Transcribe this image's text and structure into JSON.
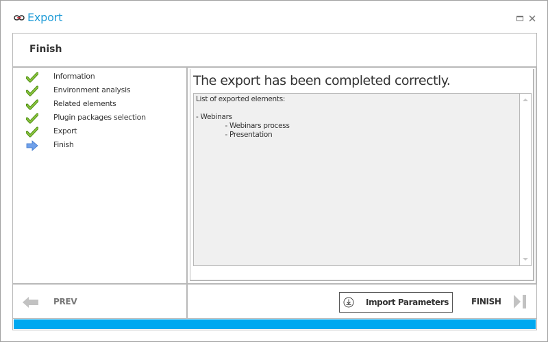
{
  "window": {
    "title": "Export",
    "title_icon": "link-icon",
    "controls": [
      {
        "name": "maximize",
        "icon": "maximize-icon"
      },
      {
        "name": "close",
        "icon": "close-icon"
      }
    ]
  },
  "header": {
    "title": "Finish"
  },
  "steps": [
    {
      "label": "Information",
      "status": "done",
      "icon": "check-icon"
    },
    {
      "label": "Environment analysis",
      "status": "done",
      "icon": "check-icon"
    },
    {
      "label": "Related elements",
      "status": "done",
      "icon": "check-icon"
    },
    {
      "label": "Plugin packages selection",
      "status": "done",
      "icon": "check-icon"
    },
    {
      "label": "Export",
      "status": "done",
      "icon": "check-icon"
    },
    {
      "label": "Finish",
      "status": "current",
      "icon": "arrow-right-icon"
    }
  ],
  "result": {
    "message": "The export has been completed correctly.",
    "log_text": "List of exported elements:\n\n- Webinars\n              - Webinars process\n              - Presentation"
  },
  "footer": {
    "prev_label": "PREV",
    "import_label": "Import Parameters",
    "finish_label": "FINISH"
  },
  "progress": {
    "value": 1.0
  },
  "colors": {
    "accent": "#1e9bd7",
    "progress": "#00a8f0",
    "check": "#6aa520",
    "arrow": "#4f8fe0",
    "disabled": "#bcbcbc"
  }
}
